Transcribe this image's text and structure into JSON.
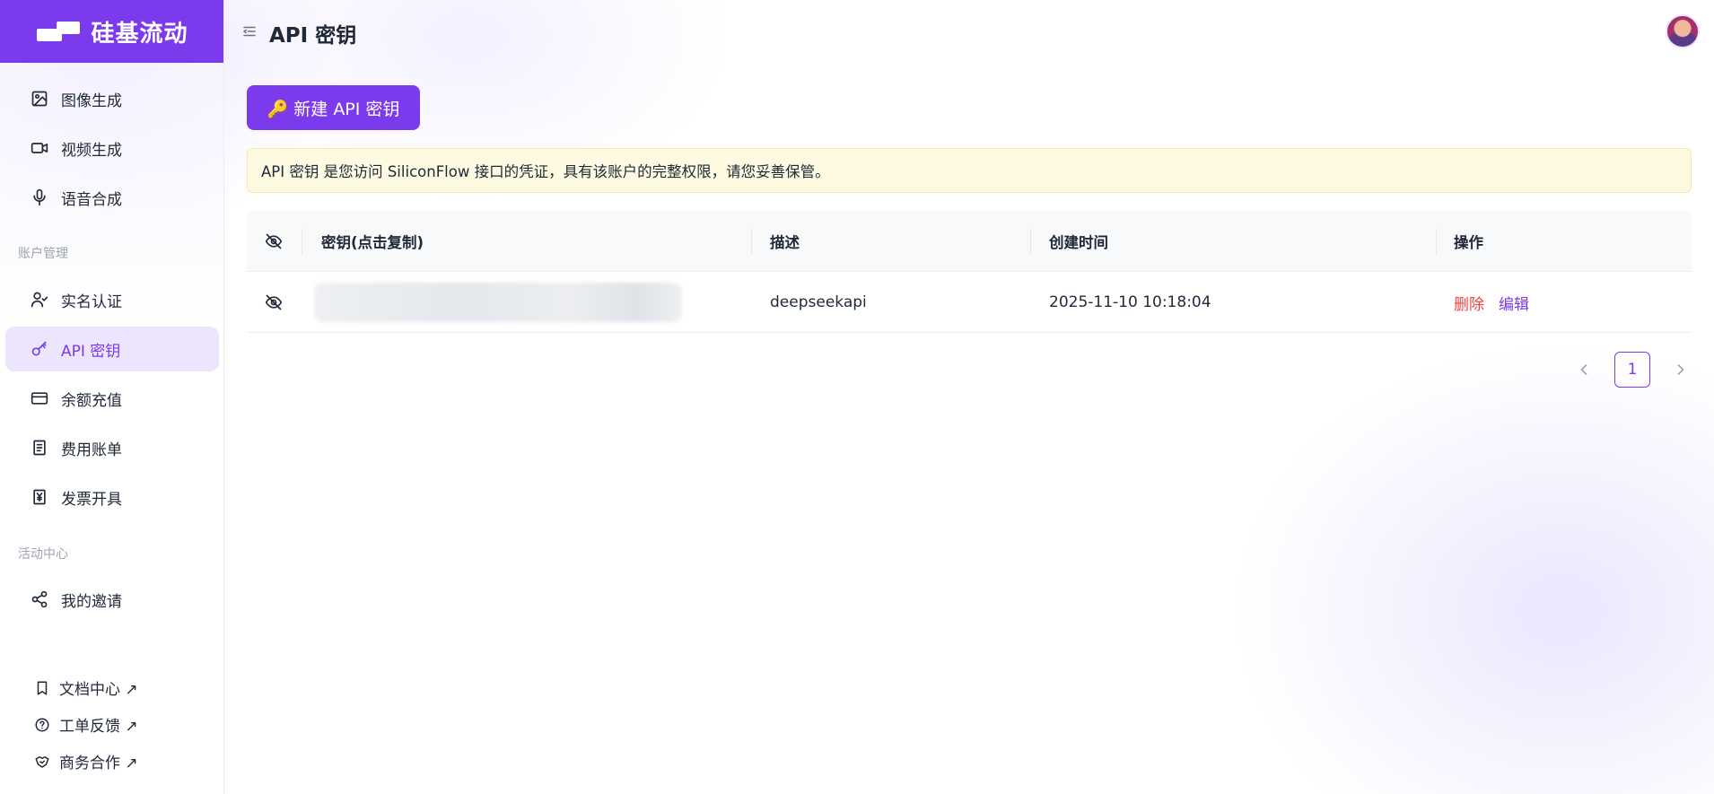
{
  "brand": {
    "name": "硅基流动"
  },
  "header": {
    "title": "API 密钥"
  },
  "sidebar": {
    "items": [
      {
        "label": "图像生成",
        "icon": "image-icon"
      },
      {
        "label": "视频生成",
        "icon": "video-icon"
      },
      {
        "label": "语音合成",
        "icon": "microphone-icon"
      }
    ],
    "section_account": "账户管理",
    "account_items": [
      {
        "label": "实名认证",
        "icon": "user-check-icon"
      },
      {
        "label": "API 密钥",
        "icon": "key-icon",
        "active": true
      },
      {
        "label": "余额充值",
        "icon": "credit-card-icon"
      },
      {
        "label": "费用账单",
        "icon": "receipt-icon"
      },
      {
        "label": "发票开具",
        "icon": "invoice-icon"
      }
    ],
    "section_activity": "活动中心",
    "activity_items": [
      {
        "label": "我的邀请",
        "icon": "share-icon"
      }
    ],
    "footer_links": [
      {
        "label": "文档中心 ↗",
        "icon": "book-icon"
      },
      {
        "label": "工单反馈 ↗",
        "icon": "help-circle-icon"
      },
      {
        "label": "商务合作 ↗",
        "icon": "handshake-icon"
      }
    ]
  },
  "main": {
    "new_key_button": "🔑 新建 API 密钥",
    "notice": "API 密钥 是您访问 SiliconFlow 接口的凭证，具有该账户的完整权限，请您妥善保管。",
    "table": {
      "columns": [
        "密钥(点击复制)",
        "描述",
        "创建时间",
        "操作"
      ],
      "rows": [
        {
          "description": "deepseekapi",
          "created": "2025-11-10 10:18:04",
          "actions": [
            "删除",
            "编辑"
          ]
        }
      ]
    },
    "pagination": {
      "current": "1"
    }
  },
  "colors": {
    "accent": "#7c3aed",
    "danger": "#ef4444",
    "notice_bg": "#fef9e1"
  }
}
